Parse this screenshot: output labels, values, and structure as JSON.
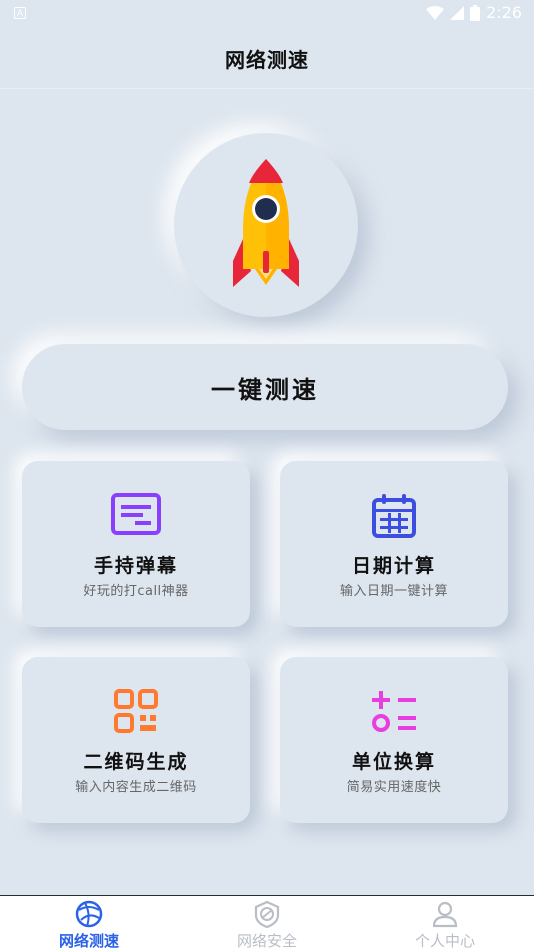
{
  "status_bar": {
    "time": "2:26",
    "indicator": "A"
  },
  "header": {
    "title": "网络测速"
  },
  "hero": {
    "icon": "rocket-icon",
    "button_label": "一键测速"
  },
  "cards": [
    {
      "title": "手持弹幕",
      "desc": "好玩的打call神器",
      "icon": "bullet-screen-icon",
      "color": "#8a3ffc"
    },
    {
      "title": "日期计算",
      "desc": "输入日期一键计算",
      "icon": "calendar-icon",
      "color": "#3b4ee0"
    },
    {
      "title": "二维码生成",
      "desc": "输入内容生成二维码",
      "icon": "qr-code-icon",
      "color": "#ff7a2e"
    },
    {
      "title": "单位换算",
      "desc": "简易实用速度快",
      "icon": "calculator-icon",
      "color": "#e83ee0"
    }
  ],
  "bottom_nav": {
    "active_color": "#2a62e8",
    "inactive_color": "#b9bec6",
    "items": [
      {
        "label": "网络测速",
        "icon": "speed-globe-icon",
        "active": true
      },
      {
        "label": "网络安全",
        "icon": "shield-icon",
        "active": false
      },
      {
        "label": "个人中心",
        "icon": "user-icon",
        "active": false
      }
    ]
  }
}
